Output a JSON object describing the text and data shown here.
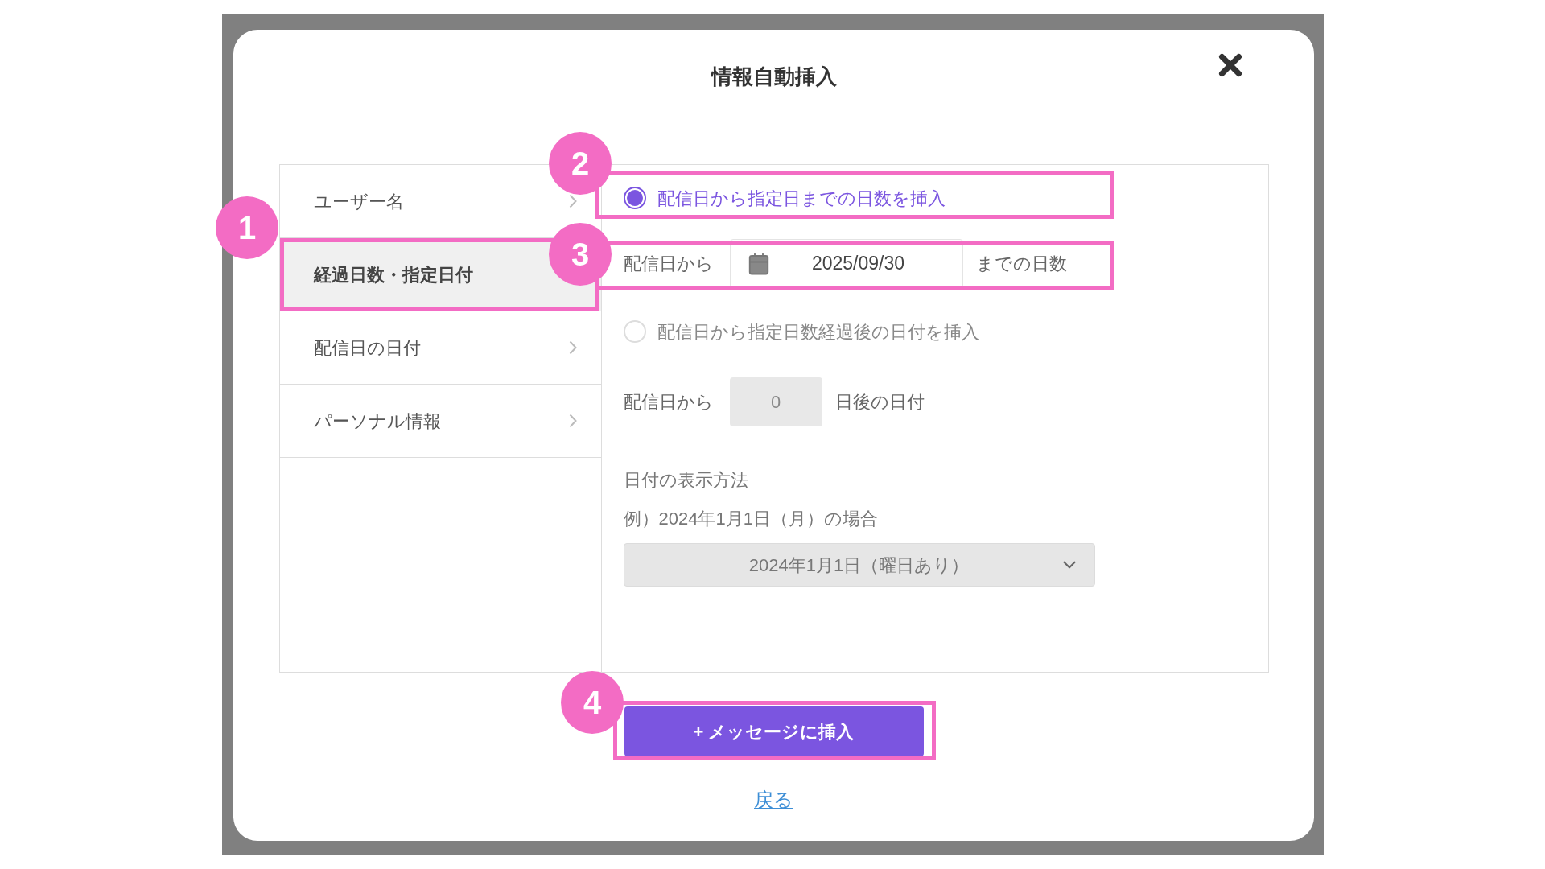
{
  "dialog": {
    "title": "情報自動挿入"
  },
  "menu": [
    {
      "label": "ユーザー名",
      "selected": false
    },
    {
      "label": "経過日数・指定日付",
      "selected": true
    },
    {
      "label": "配信日の日付",
      "selected": false
    },
    {
      "label": "パーソナル情報",
      "selected": false
    }
  ],
  "options": [
    {
      "label": "配信日から指定日までの日数を挿入",
      "selected": true,
      "row": {
        "prefix": "配信日から",
        "kind": "date",
        "value": "2025/09/30",
        "suffix": "までの日数"
      }
    },
    {
      "label": "配信日から指定日数経過後の日付を挿入",
      "selected": false,
      "row": {
        "prefix": "配信日から",
        "kind": "number",
        "value": "0",
        "suffix": "日後の日付"
      }
    }
  ],
  "date_format": {
    "label": "日付の表示方法",
    "example": "例）2024年1月1日（月）の場合",
    "select": "2024年1月1日（曜日あり）"
  },
  "insert_button": "+ メッセージに挿入",
  "back_link": "戻る",
  "callouts": [
    "1",
    "2",
    "3",
    "4"
  ]
}
